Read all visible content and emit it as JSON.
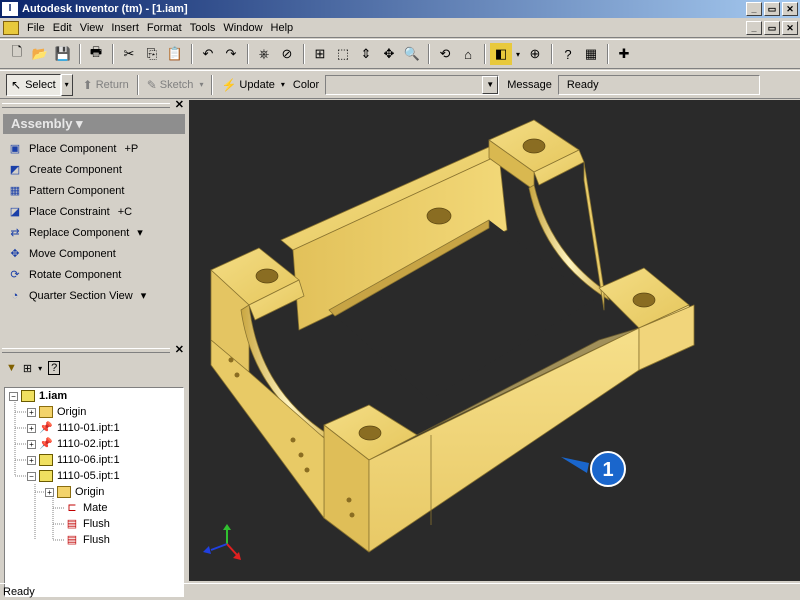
{
  "window": {
    "title": "Autodesk Inventor (tm) - [1.iam]",
    "min": "_",
    "max": "▭",
    "close": "✕"
  },
  "menu": [
    "File",
    "Edit",
    "View",
    "Insert",
    "Format",
    "Tools",
    "Window",
    "Help"
  ],
  "toolbar2": {
    "select_label": "Select",
    "return_label": "Return",
    "sketch_label": "Sketch",
    "update_label": "Update",
    "color_label": "Color",
    "color_value": "",
    "message_label": "Message",
    "message_value": "Ready"
  },
  "assembly_panel": {
    "header": "Assembly ▾",
    "commands": [
      {
        "label": "Place Component",
        "hotkey": "+P",
        "icon": "place-component-icon"
      },
      {
        "label": "Create Component",
        "hotkey": "",
        "icon": "create-component-icon"
      },
      {
        "label": "Pattern Component",
        "hotkey": "",
        "icon": "pattern-component-icon"
      },
      {
        "label": "Place Constraint",
        "hotkey": "+C",
        "icon": "place-constraint-icon"
      },
      {
        "label": "Replace Component",
        "hotkey": "▾",
        "icon": "replace-component-icon"
      },
      {
        "label": "Move Component",
        "hotkey": "",
        "icon": "move-component-icon"
      },
      {
        "label": "Rotate Component",
        "hotkey": "",
        "icon": "rotate-component-icon"
      },
      {
        "label": "Quarter Section View",
        "hotkey": "▾",
        "icon": "section-view-icon"
      }
    ]
  },
  "browser": {
    "tree": [
      {
        "label": "1.iam",
        "bold": true
      },
      {
        "label": "Origin"
      },
      {
        "label": "1110-01.ipt:1"
      },
      {
        "label": "1110-02.ipt:1"
      },
      {
        "label": "1110-06.ipt:1"
      },
      {
        "label": "1110-05.ipt:1"
      },
      {
        "label": "Origin"
      },
      {
        "label": "Mate"
      },
      {
        "label": "Flush"
      },
      {
        "label": "Flush"
      }
    ]
  },
  "viewport": {
    "callout_number": "1",
    "model_color": "#e8cf6a",
    "background": "#2a2a2a"
  },
  "status": "Ready",
  "colors": {
    "titlebar_start": "#0a246a",
    "titlebar_end": "#a6caf0",
    "callout": "#1a66cc"
  }
}
